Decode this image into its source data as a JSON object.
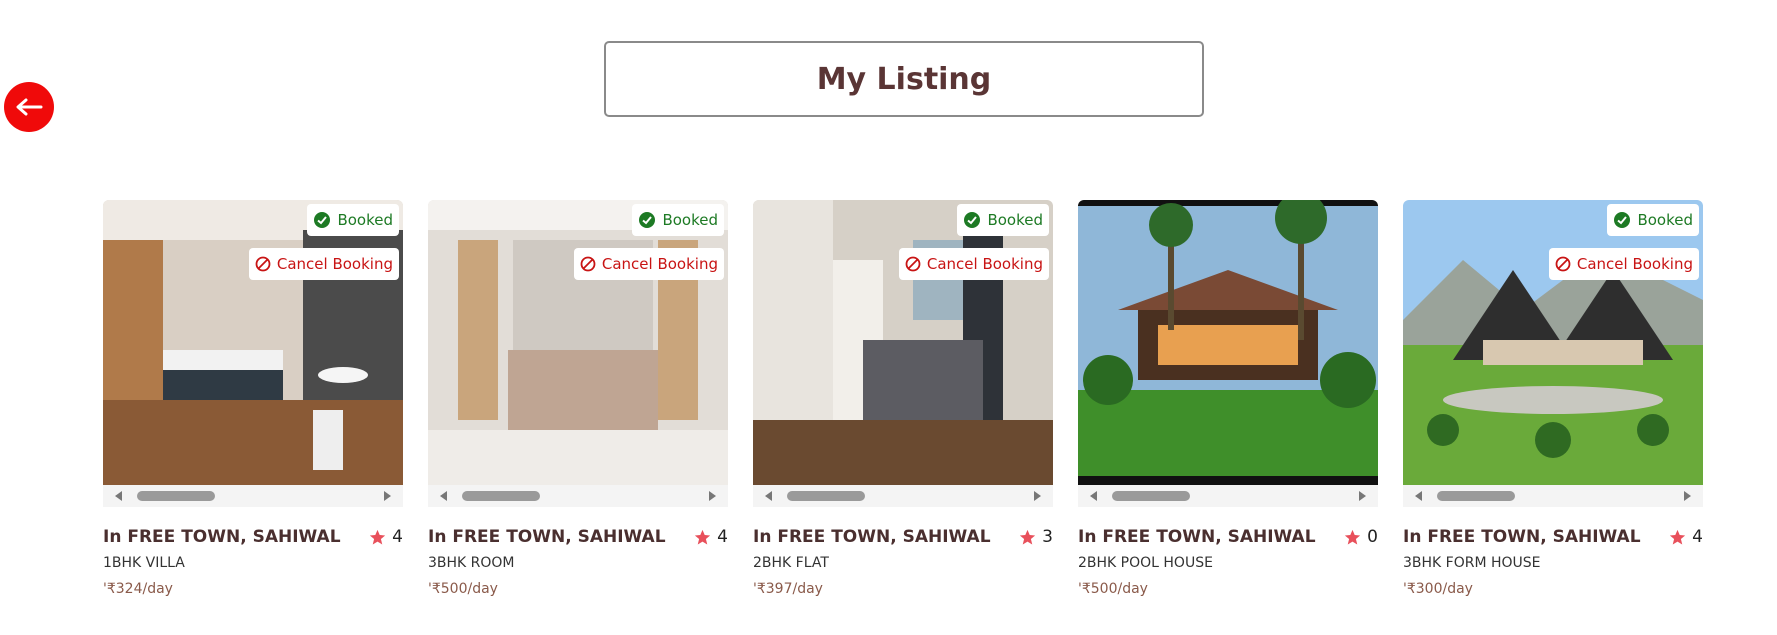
{
  "page": {
    "title": "My Listing"
  },
  "colors": {
    "accent": "#f00a0a",
    "booked": "#1d7a24",
    "cancel": "#c81414",
    "star": "#e8505b"
  },
  "listings": [
    {
      "location": "In FREE TOWN, SAHIWAL",
      "rating": "4",
      "type": "1BHK VILLA",
      "price": "'₹324/day",
      "booked_label": "Booked",
      "cancel_label": "Cancel Booking",
      "photo": "bedroom-photo"
    },
    {
      "location": "In FREE TOWN, SAHIWAL",
      "rating": "4",
      "type": "3BHK ROOM",
      "price": "'₹500/day",
      "booked_label": "Booked",
      "cancel_label": "Cancel Booking",
      "photo": "bedroom-photo"
    },
    {
      "location": "In FREE TOWN, SAHIWAL",
      "rating": "3",
      "type": "2BHK FLAT",
      "price": "'₹397/day",
      "booked_label": "Booked",
      "cancel_label": "Cancel Booking",
      "photo": "bedroom-photo"
    },
    {
      "location": "In FREE TOWN, SAHIWAL",
      "rating": "0",
      "type": "2BHK POOL HOUSE",
      "price": "'₹500/day",
      "photo": "pool-house-photo"
    },
    {
      "location": "In FREE TOWN, SAHIWAL",
      "rating": "4",
      "type": "3BHK FORM HOUSE",
      "price": "'₹300/day",
      "booked_label": "Booked",
      "cancel_label": "Cancel Booking",
      "photo": "farm-house-photo"
    }
  ]
}
